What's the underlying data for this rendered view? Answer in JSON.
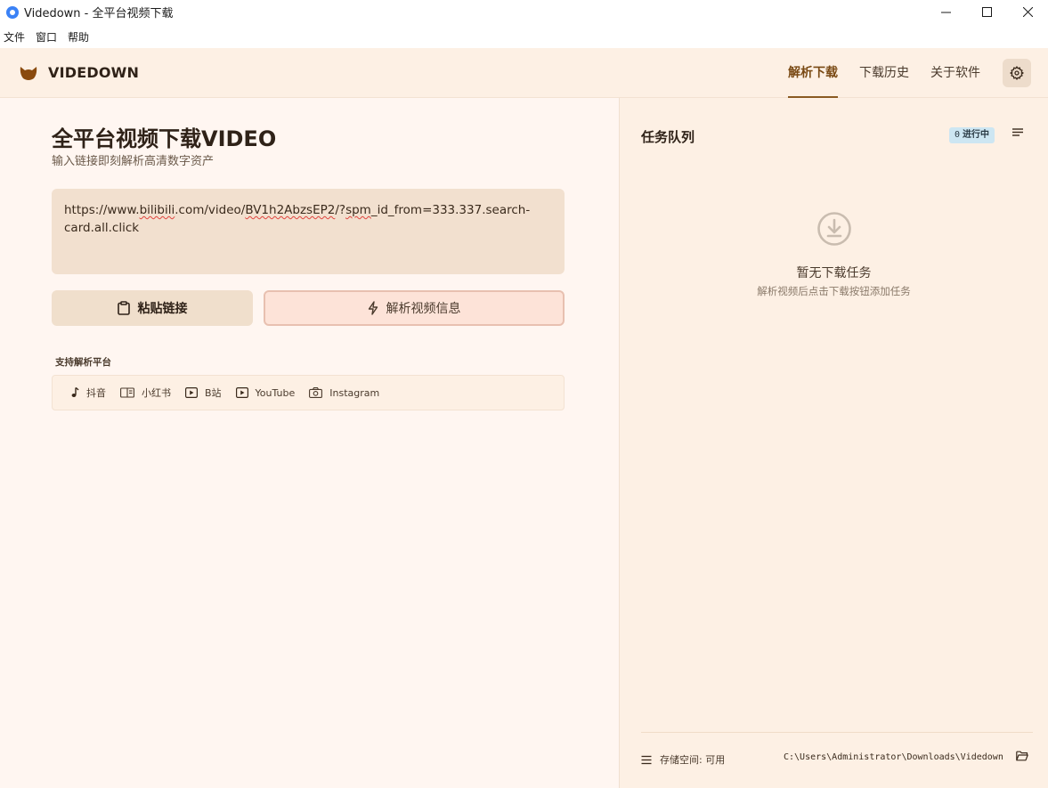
{
  "window": {
    "title": "Videdown - 全平台视频下载",
    "controls": [
      "minimize",
      "maximize",
      "close"
    ]
  },
  "menu": [
    "文件",
    "窗口",
    "帮助"
  ],
  "header": {
    "brand": "VIDEDOWN",
    "nav": [
      {
        "label": "解析下载",
        "active": true
      },
      {
        "label": "下载历史",
        "active": false
      },
      {
        "label": "关于软件",
        "active": false
      }
    ]
  },
  "main": {
    "title": "全平台视频下载VIDEO",
    "subtitle": "输入链接即刻解析高清数字资产",
    "url_value_parts": [
      "https://www.",
      "bilibili",
      ".com/video/",
      "BV1h2AbzsEP2",
      "/?",
      "spm",
      "_id_from=333.337.search-card.all.click"
    ],
    "paste_button": "粘贴链接",
    "parse_button": "解析视频信息",
    "platforms_label": "支持解析平台",
    "platforms": [
      {
        "name": "抖音",
        "icon": "music-note-icon"
      },
      {
        "name": "小红书",
        "icon": "book-icon"
      },
      {
        "name": "B站",
        "icon": "play-box-icon"
      },
      {
        "name": "YouTube",
        "icon": "play-box-icon"
      },
      {
        "name": "Instagram",
        "icon": "camera-icon"
      }
    ]
  },
  "queue": {
    "title": "任务队列",
    "badge_count": "0",
    "badge_label": "进行中",
    "empty_title": "暂无下载任务",
    "empty_desc": "解析视频后点击下载按钮添加任务",
    "storage_label": "存储空间: 可用",
    "path": "C:\\Users\\Administrator\\Downloads\\Videdown"
  },
  "colors": {
    "accent": "#8a5a22",
    "header_bg": "#fdf0e4",
    "left_bg": "#fff6f1",
    "badge_bg": "#cde6f2"
  }
}
